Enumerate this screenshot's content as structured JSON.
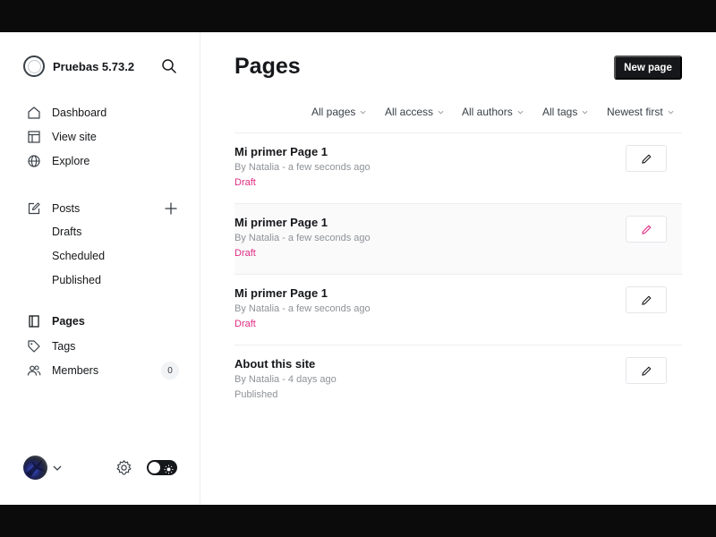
{
  "sidebar": {
    "site_title": "Pruebas 5.73.2",
    "nav": [
      {
        "label": "Dashboard",
        "icon": "home-icon"
      },
      {
        "label": "View site",
        "icon": "layout-icon"
      },
      {
        "label": "Explore",
        "icon": "globe-icon"
      }
    ],
    "posts": {
      "label": "Posts",
      "icon": "edit-icon",
      "sub_items": [
        "Drafts",
        "Scheduled",
        "Published"
      ]
    },
    "pages": {
      "label": "Pages",
      "icon": "page-icon",
      "active": true
    },
    "tags": {
      "label": "Tags",
      "icon": "tag-icon"
    },
    "members": {
      "label": "Members",
      "icon": "members-icon",
      "count": "0"
    }
  },
  "main": {
    "title": "Pages",
    "new_button": "New page",
    "filters": [
      "All pages",
      "All access",
      "All authors",
      "All tags",
      "Newest first"
    ],
    "pages": [
      {
        "title": "Mi primer Page 1",
        "meta": "By Natalia - a few seconds ago",
        "status": "Draft"
      },
      {
        "title": "Mi primer Page 1",
        "meta": "By Natalia - a few seconds ago",
        "status": "Draft"
      },
      {
        "title": "Mi primer Page 1",
        "meta": "By Natalia - a few seconds ago",
        "status": "Draft"
      },
      {
        "title": "About this site",
        "meta": "By Natalia - 4 days ago",
        "status": "Published"
      }
    ]
  },
  "colors": {
    "accent_pink": "#e02d83",
    "text_dark": "#15171a",
    "text_muted": "#8e9297"
  }
}
